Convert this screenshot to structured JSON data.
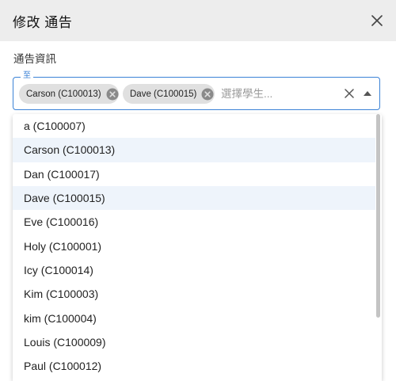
{
  "dialog": {
    "title": "修改 通告",
    "close_icon": "close-icon"
  },
  "section": {
    "label": "通告資訊"
  },
  "recipients_field": {
    "legend": "至",
    "chips": [
      {
        "label": "Carson (C100013)"
      },
      {
        "label": "Dave (C100015)"
      }
    ],
    "placeholder": "選擇學生...",
    "clear_icon": "clear-icon",
    "popup_icon": "arrow-up-icon",
    "accent_color": "#3b82d6"
  },
  "options": [
    {
      "label": "a (C100007)",
      "selected": false
    },
    {
      "label": "Carson (C100013)",
      "selected": true
    },
    {
      "label": "Dan (C100017)",
      "selected": false
    },
    {
      "label": "Dave (C100015)",
      "selected": true
    },
    {
      "label": "Eve (C100016)",
      "selected": false
    },
    {
      "label": "Holy (C100001)",
      "selected": false
    },
    {
      "label": "Icy (C100014)",
      "selected": false
    },
    {
      "label": "Kim (C100003)",
      "selected": false
    },
    {
      "label": "kim (C100004)",
      "selected": false
    },
    {
      "label": "Louis (C100009)",
      "selected": false
    },
    {
      "label": "Paul (C100012)",
      "selected": false
    }
  ]
}
